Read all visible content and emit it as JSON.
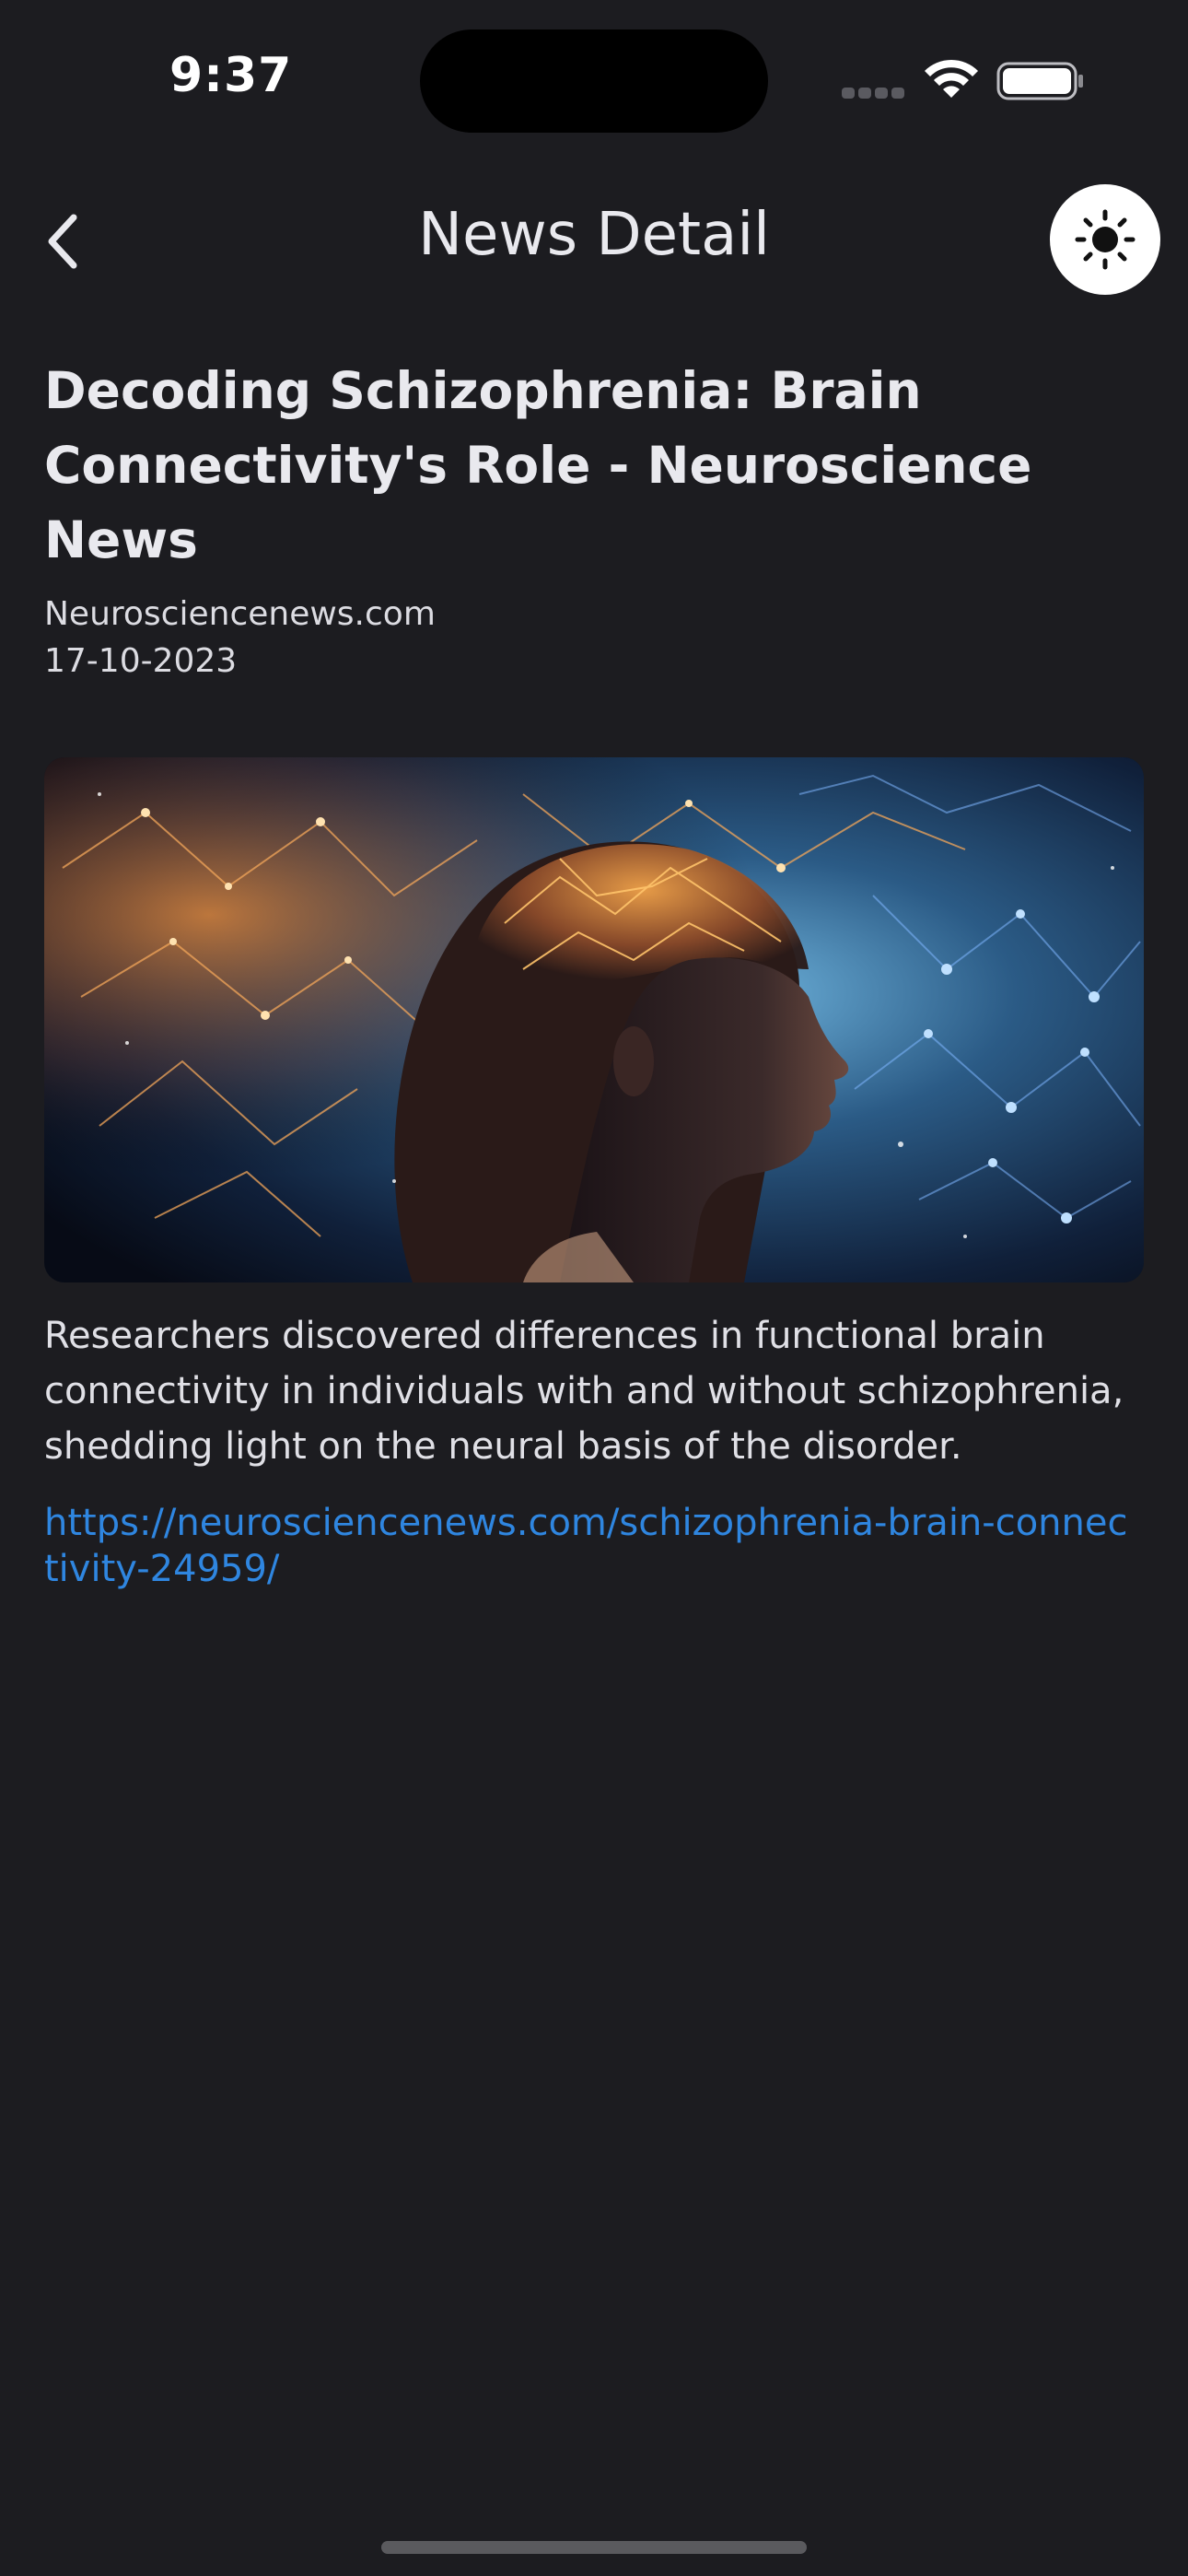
{
  "status_bar": {
    "time": "9:37",
    "icons": [
      "cell-signal-icon",
      "wifi-icon",
      "battery-icon"
    ]
  },
  "nav": {
    "title": "News Detail",
    "back_icon": "chevron-left-icon",
    "theme_toggle_icon": "sun-icon"
  },
  "article": {
    "title": "Decoding Schizophrenia: Brain Connectivity's Role - Neuroscience News",
    "source": "Neurosciencenews.com",
    "date": "17-10-2023",
    "image_description_icon": "brain-network-illustration",
    "description": "Researchers discovered differences in functional brain connectivity in individuals with and without schizophrenia, shedding light on the neural basis of the disorder.",
    "url": "https://neurosciencenews.com/schizophrenia-brain-connectivity-24959/"
  },
  "colors": {
    "background": "#1c1c20",
    "text": "#e9e9ee",
    "link": "#2f86e0",
    "toggle_bg": "#ffffff"
  }
}
